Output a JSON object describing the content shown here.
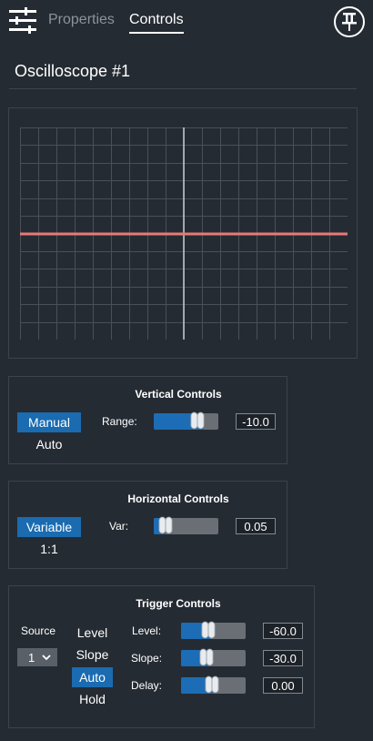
{
  "header": {
    "tabs": [
      {
        "label": "Properties",
        "active": false
      },
      {
        "label": "Controls",
        "active": true
      }
    ],
    "settings_icon": "sliders-icon",
    "pin_icon": "pin-icon"
  },
  "page_title": "Oscilloscope #1",
  "scope": {
    "trace_color": "#e87a73",
    "grid_color": "#4a5058",
    "axis_color": "#c8ccd0"
  },
  "vertical": {
    "title": "Vertical Controls",
    "modes": [
      {
        "label": "Manual",
        "selected": true
      },
      {
        "label": "Auto",
        "selected": false
      }
    ],
    "range": {
      "label": "Range:",
      "value": "-10.0",
      "fill": 0.78
    }
  },
  "horizontal": {
    "title": "Horizontal Controls",
    "modes": [
      {
        "label": "Variable",
        "selected": true
      },
      {
        "label": "1:1",
        "selected": false
      }
    ],
    "var": {
      "label": "Var:",
      "value": "0.05",
      "fill": 0.18
    }
  },
  "trigger": {
    "title": "Trigger Controls",
    "source": {
      "label": "Source",
      "value": "1"
    },
    "modes": [
      {
        "label": "Level",
        "selected": false
      },
      {
        "label": "Slope",
        "selected": false
      },
      {
        "label": "Auto",
        "selected": true
      },
      {
        "label": "Hold",
        "selected": false
      }
    ],
    "level": {
      "label": "Level:",
      "value": "-60.0",
      "fill": 0.45
    },
    "slope": {
      "label": "Slope:",
      "value": "-30.0",
      "fill": 0.42
    },
    "delay": {
      "label": "Delay:",
      "value": "0.00",
      "fill": 0.5
    }
  },
  "colors": {
    "background": "#252b33",
    "accent": "#1a6bb0"
  }
}
